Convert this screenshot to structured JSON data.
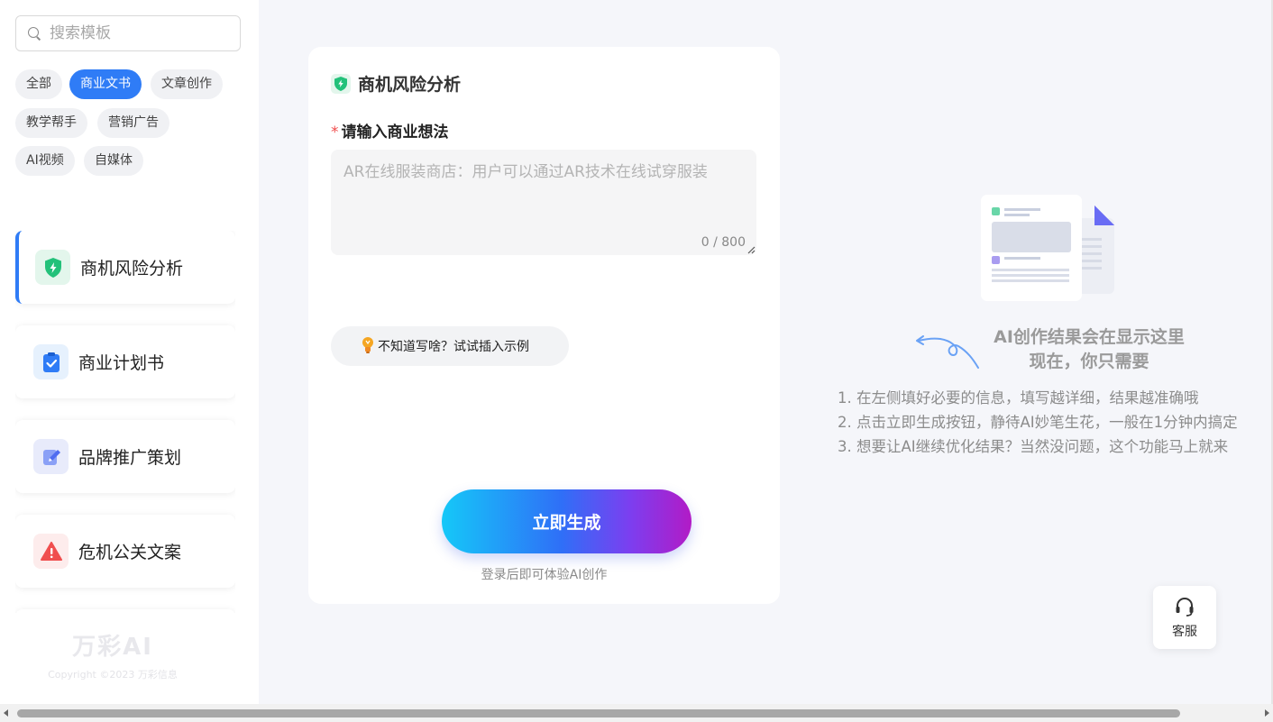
{
  "search": {
    "placeholder": "搜索模板"
  },
  "categories": [
    {
      "label": "全部",
      "active": false
    },
    {
      "label": "商业文书",
      "active": true
    },
    {
      "label": "文章创作",
      "active": false
    },
    {
      "label": "教学帮手",
      "active": false
    },
    {
      "label": "营销广告",
      "active": false
    },
    {
      "label": "AI视频",
      "active": false
    },
    {
      "label": "自媒体",
      "active": false
    }
  ],
  "templates": [
    {
      "label": "商机风险分析",
      "icon": "shield-bolt-icon",
      "active": true
    },
    {
      "label": "商业计划书",
      "icon": "clipboard-check-icon",
      "active": false
    },
    {
      "label": "品牌推广策划",
      "icon": "pen-edit-icon",
      "active": false
    },
    {
      "label": "危机公关文案",
      "icon": "warning-icon",
      "active": false
    }
  ],
  "brand": {
    "logo": "万彩AI",
    "copyright": "Copyright ©2023 万彩信息"
  },
  "form": {
    "title": "商机风险分析",
    "required_mark": "*",
    "field_label": "请输入商业想法",
    "textarea_placeholder": "AR在线服装商店：用户可以通过AR技术在线试穿服装",
    "textarea_value": "",
    "counter": "0 / 800",
    "example_button": "不知道写啥？试试插入示例",
    "generate_button": "立即生成",
    "login_hint": "登录后即可体验AI创作"
  },
  "result": {
    "title_line1": "AI创作结果会在显示这里",
    "title_line2": "现在，你只需要",
    "steps": [
      "1. 在左侧填好必要的信息，填写越详细，结果越准确哦",
      "2. 点击立即生成按钮，静待AI妙笔生花，一般在1分钟内搞定",
      "3. 想要让AI继续优化结果？当然没问题，这个功能马上就来"
    ]
  },
  "service": {
    "label": "客服",
    "icon": "headset-icon"
  },
  "colors": {
    "accent": "#2f7cf6",
    "green": "#23c17a",
    "danger": "#f04e4e"
  }
}
